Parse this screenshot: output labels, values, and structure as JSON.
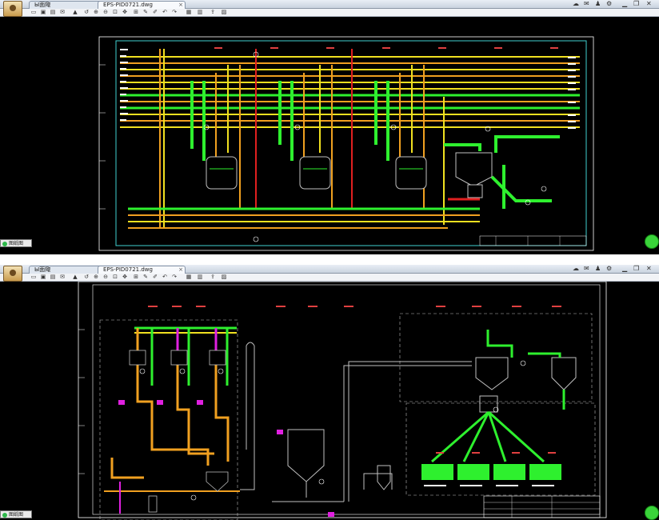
{
  "windows": [
    {
      "tabs": [
        {
          "label": "Ы面陬",
          "active": false
        },
        {
          "label": "EPS-PID0721.dwg",
          "active": true
        }
      ],
      "drawing": "P&ID — expandable polystyrene reactors section",
      "status_button": "图纸图"
    },
    {
      "tabs": [
        {
          "label": "Ы面陬",
          "active": false
        },
        {
          "label": "EPS-PID0721.dwg",
          "active": true
        }
      ],
      "drawing": "P&ID — dryer, cyclone and packing section",
      "status_button": "图纸图"
    }
  ],
  "colors": {
    "background": "#000000",
    "frame": "#ffffff",
    "border_cyan": "#3fd0d0",
    "pipe_orange": "#f0a020",
    "pipe_green": "#2ef02e",
    "pipe_yellow": "#f0e020",
    "pipe_red": "#e02020",
    "pipe_magenta": "#e020e0",
    "equipment": "#c0c0c0",
    "tag": "#e04040"
  },
  "icons": [
    "folder-open-icon",
    "save-icon",
    "print-icon",
    "undo-icon",
    "zoom-icon",
    "pan-icon",
    "layer-icon",
    "measure-icon"
  ]
}
